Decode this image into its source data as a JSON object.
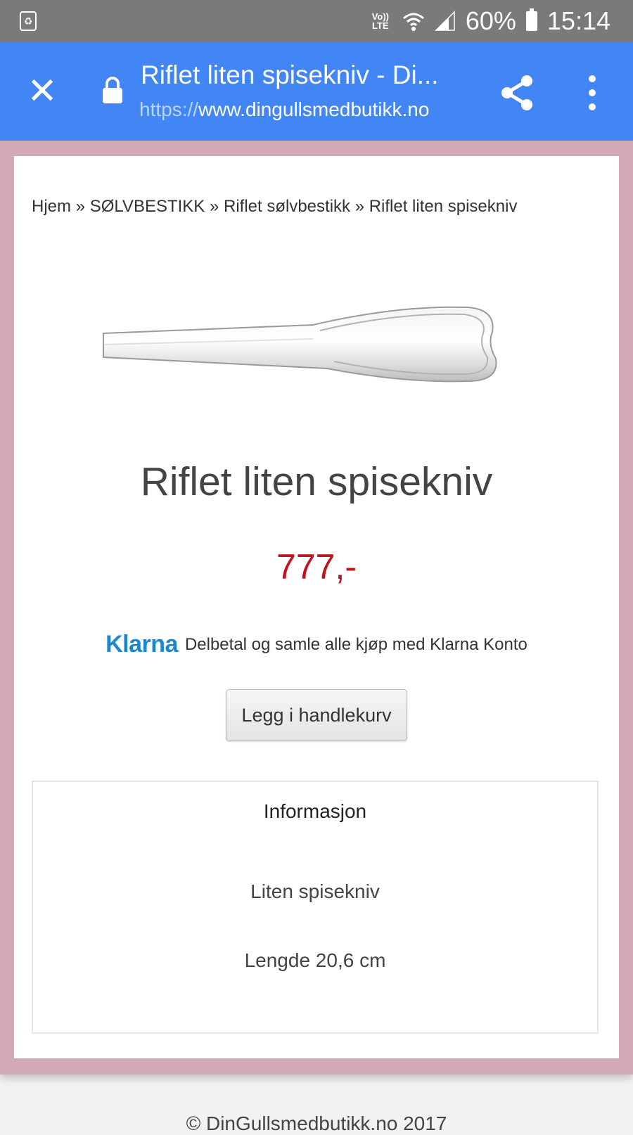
{
  "status_bar": {
    "network_label": "Vo)) LTE",
    "battery_percent": "60%",
    "time": "15:14"
  },
  "toolbar": {
    "page_title": "Riflet liten spisekniv - Di...",
    "url_scheme": "https://",
    "url_host": "www.dingullsmedbutikk.no",
    "toolbar_color": "#4285f4"
  },
  "breadcrumb": "Hjem » SØLVBESTIKK » Riflet sølvbestikk » Riflet liten spisekniv",
  "product": {
    "title": "Riflet liten spisekniv",
    "price": "777,-",
    "price_color": "#c0141b"
  },
  "klarna": {
    "logo_text": "Klarna",
    "text": "Delbetal og samle alle kjøp med Klarna Konto"
  },
  "cart_button_label": "Legg i handlekurv",
  "info": {
    "heading": "Informasjon",
    "line1": "Liten spisekniv",
    "line2": "Lengde 20,6 cm"
  },
  "footer": "© DinGullsmedbutikk.no 2017",
  "icons": [
    "recycle-icon",
    "wifi-icon",
    "signal-icon",
    "battery-icon",
    "close-icon",
    "lock-icon",
    "share-icon",
    "more-icon"
  ]
}
